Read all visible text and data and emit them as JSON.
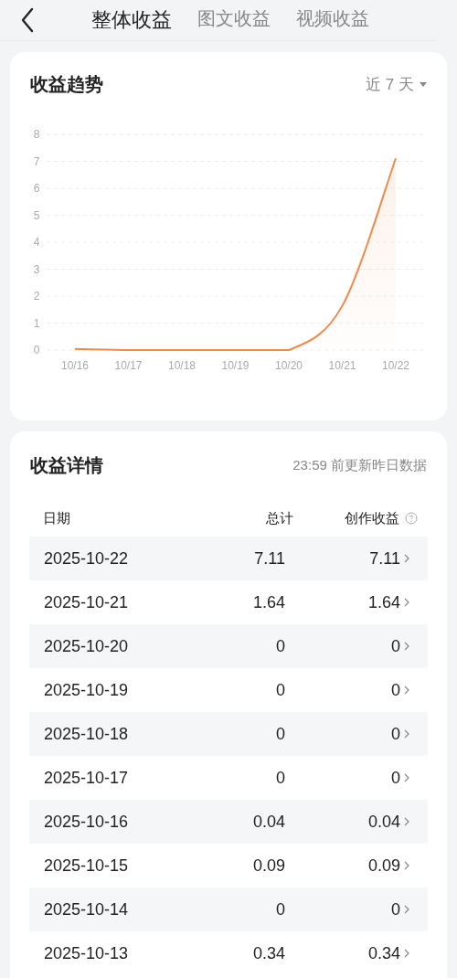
{
  "tabs": [
    {
      "label": "整体收益",
      "selected": true
    },
    {
      "label": "图文收益",
      "selected": false
    },
    {
      "label": "视频收益",
      "selected": false
    }
  ],
  "trend": {
    "title": "收益趋势",
    "range": "近 7 天",
    "chart_data": {
      "type": "line",
      "categories": [
        "10/16",
        "10/17",
        "10/18",
        "10/19",
        "10/20",
        "10/21",
        "10/22"
      ],
      "series": [
        {
          "color": "#f08a4b",
          "values": [
            0.04,
            0,
            0,
            0,
            0,
            1.64,
            7.11
          ]
        }
      ],
      "ylim": [
        0,
        8
      ],
      "grid": true,
      "yticks": [
        0,
        1,
        2,
        3,
        4,
        5,
        6,
        7,
        8
      ]
    }
  },
  "details": {
    "title": "收益详情",
    "note": "23:59 前更新昨日数据",
    "columns": [
      "日期",
      "总计",
      "创作收益"
    ],
    "rows": [
      {
        "date": "2025-10-22",
        "total": "7.11",
        "creation": "7.11"
      },
      {
        "date": "2025-10-21",
        "total": "1.64",
        "creation": "1.64"
      },
      {
        "date": "2025-10-20",
        "total": "0",
        "creation": "0"
      },
      {
        "date": "2025-10-19",
        "total": "0",
        "creation": "0"
      },
      {
        "date": "2025-10-18",
        "total": "0",
        "creation": "0"
      },
      {
        "date": "2025-10-17",
        "total": "0",
        "creation": "0"
      },
      {
        "date": "2025-10-16",
        "total": "0.04",
        "creation": "0.04"
      },
      {
        "date": "2025-10-15",
        "total": "0.09",
        "creation": "0.09"
      },
      {
        "date": "2025-10-14",
        "total": "0",
        "creation": "0"
      },
      {
        "date": "2025-10-13",
        "total": "0.34",
        "creation": "0.34"
      }
    ]
  }
}
